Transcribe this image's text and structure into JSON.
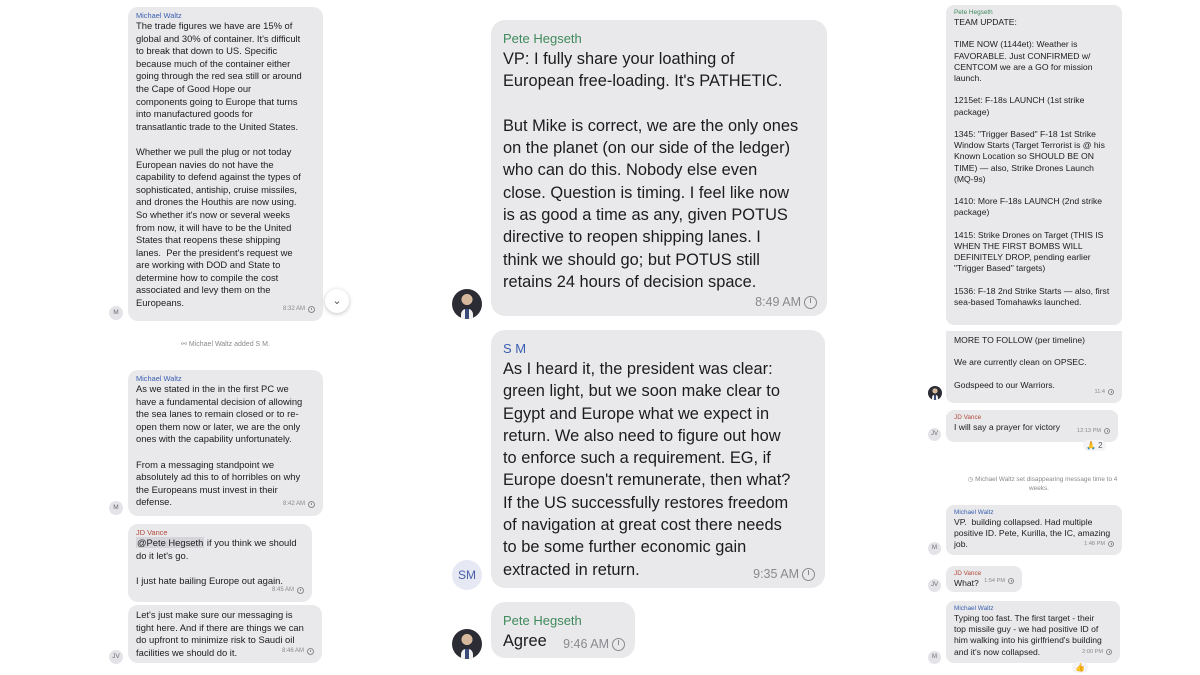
{
  "left": {
    "msg1": {
      "sender": "Michael Waltz",
      "text": "The trade figures we have are 15% of\nglobal and 30% of container. It's difficult\nto break that down to US. Specific\nbecause much of the container either\ngoing through the red sea still or around\nthe Cape of Good Hope our\ncomponents going to Europe that turns\ninto manufactured goods for\ntransatlantic trade to the United States.\n\nWhether we pull the plug or not today\nEuropean navies do not have the\ncapability to defend against the types of\nsophisticated, antiship, cruise missiles,\nand drones the Houthis are now using.\nSo whether it's now or several weeks\nfrom now, it will have to be the United\nStates that reopens these shipping\nlanes.  Per the president's request we\nare working with DOD and State to\ndetermine how to compile the cost\nassociated and levy them on the\nEuropeans.",
      "time": "8:32 AM",
      "avatar": "M"
    },
    "system_added": "Michael Waltz added S M.",
    "msg2": {
      "sender": "Michael Waltz",
      "text": "As we stated in the in the first PC we\nhave a fundamental decision of allowing\nthe sea lanes to remain closed or to re-\nopen them now or later, we are the only\nones with the capability unfortunately.\n\nFrom a messaging standpoint we\nabsolutely ad this to of horribles on why\nthe Europeans must invest in their\ndefense.",
      "time": "8:42 AM",
      "avatar": "M"
    },
    "msg3": {
      "sender": "JD Vance",
      "mention": "@Pete Hegseth",
      "text_after_mention": " if you think we should\ndo it let's go.\n\nI just hate bailing Europe out again.",
      "time": "8:45 AM"
    },
    "msg4": {
      "text": "Let's just make sure our messaging is\ntight here. And if there are things we can\ndo upfront to minimize risk to Saudi oil\nfacilities we should do it.",
      "time": "8:46 AM",
      "avatar": "JV"
    }
  },
  "middle": {
    "msg1": {
      "sender": "Pete Hegseth",
      "text": "VP: I fully share your loathing of\nEuropean free-loading. It's PATHETIC.\n\nBut Mike is correct, we are the only ones\non the planet (on our side of the ledger)\nwho can do this. Nobody else even\nclose. Question is timing. I feel like now\nis as good a time as any, given POTUS\ndirective to reopen shipping lanes. I\nthink we should go; but POTUS still\nretains 24 hours of decision space.",
      "time": "8:49 AM"
    },
    "msg2": {
      "sender": "S M",
      "text": "As I heard it, the president was clear:\ngreen light, but we soon make clear to\nEgypt and Europe what we expect in\nreturn. We also need to figure out how\nto enforce such a requirement. EG, if\nEurope doesn't remunerate, then what?\nIf the US successfully restores freedom\nof navigation at great cost there needs\nto be some further economic gain\nextracted in return.",
      "time": "9:35 AM",
      "avatar": "SM"
    },
    "msg3": {
      "sender": "Pete Hegseth",
      "text": "Agree",
      "time": "9:46 AM"
    }
  },
  "right": {
    "msg1": {
      "sender": "Pete Hegseth",
      "text": "TEAM UPDATE:\n\nTIME NOW (1144et): Weather is\nFAVORABLE. Just CONFIRMED w/\nCENTCOM we are a GO for mission\nlaunch.\n\n1215et: F-18s LAUNCH (1st strike\npackage)\n\n1345: \"Trigger Based\" F-18 1st Strike\nWindow Starts (Target Terrorist is @ his\nKnown Location so SHOULD BE ON\nTIME) — also, Strike Drones Launch\n(MQ-9s)\n\n1410: More F-18s LAUNCH (2nd strike\npackage)\n\n1415: Strike Drones on Target (THIS IS\nWHEN THE FIRST BOMBS WILL\nDEFINITELY DROP, pending earlier\n\"Trigger Based\" targets)\n\n1536: F-18 2nd Strike Starts — also, first\nsea-based Tomahawks launched."
    },
    "msg2": {
      "text": "MORE TO FOLLOW (per timeline)\n\nWe are currently clean on OPSEC.\n\nGodspeed to our Warriors.",
      "time": "11:4"
    },
    "msg3": {
      "sender": "JD Vance",
      "text": "I will say a prayer for victory",
      "time": "12:13 PM",
      "reaction": "🙏 2",
      "avatar": "JV"
    },
    "system_timer": "Michael Waltz set disappearing message time to 4\nweeks.",
    "msg4": {
      "sender": "Michael Waltz",
      "text": "VP.  building collapsed. Had multiple\npositive ID. Pete, Kurilla, the IC, amazing\njob.",
      "time": "1:48 PM",
      "avatar": "M"
    },
    "msg5": {
      "sender": "JD Vance",
      "text": "What?",
      "time": "1:54 PM",
      "avatar": "JV"
    },
    "msg6": {
      "sender": "Michael Waltz",
      "text": "Typing too fast. The first target - their\ntop missile guy - we had positive ID of\nhim walking into his girlfriend's building\nand it's now collapsed.",
      "time": "2:00 PM",
      "reaction": "👍",
      "avatar": "M"
    }
  },
  "icons": {
    "scroll_down": "chevron-down-icon",
    "clock": "clock-icon",
    "person_add": "person-add-icon",
    "timer": "timer-icon"
  },
  "colors": {
    "bubble": "#e9e9eb",
    "sender_blue": "#3a5fb0",
    "sender_red": "#b34a3a",
    "sender_green": "#3f8a5c",
    "timestamp": "#8a8a8e"
  }
}
